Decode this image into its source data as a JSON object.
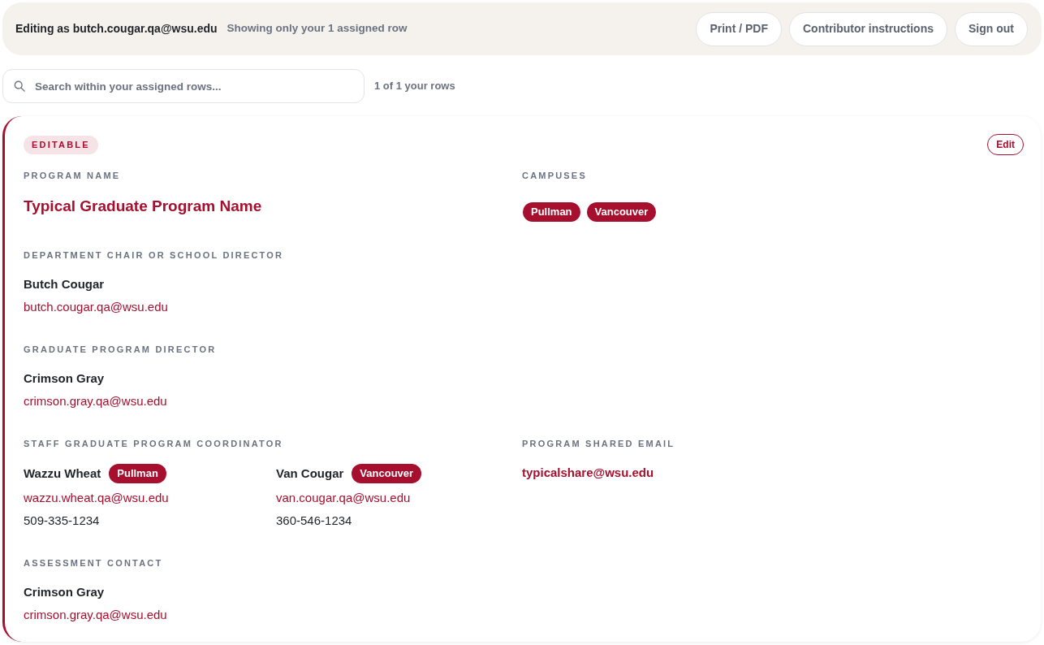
{
  "header": {
    "user_text": "Editing as butch.cougar.qa@wsu.edu",
    "scope_text": "Showing only your 1 assigned row",
    "buttons": [
      "Print / PDF",
      "Contributor instructions",
      "Sign out"
    ]
  },
  "search": {
    "placeholder": "Search within your assigned rows...",
    "count": "1 of 1 your rows"
  },
  "record": {
    "badge": "EDITABLE",
    "edit_button": "Edit",
    "rows": [
      [
        {
          "kind": "title",
          "label": "PROGRAM NAME",
          "value": "Typical Graduate Program Name"
        },
        {
          "kind": "tags",
          "label": "CAMPUSES",
          "tags": [
            "Pullman",
            "Vancouver"
          ]
        }
      ],
      [
        {
          "kind": "person",
          "label": "DEPARTMENT CHAIR OR SCHOOL DIRECTOR",
          "name": "Butch Cougar",
          "email": "butch.cougar.qa@wsu.edu"
        }
      ],
      [
        {
          "kind": "person",
          "label": "GRADUATE PROGRAM DIRECTOR",
          "name": "Crimson Gray",
          "email": "crimson.gray.qa@wsu.edu"
        }
      ],
      [
        {
          "kind": "team",
          "label": "STAFF GRADUATE PROGRAM COORDINATOR",
          "people": [
            {
              "name": "Wazzu Wheat",
              "tag": "Pullman",
              "email": "wazzu.wheat.qa@wsu.edu",
              "phone": "509-335-1234"
            },
            {
              "name": "Van Cougar",
              "tag": "Vancouver",
              "email": "van.cougar.qa@wsu.edu",
              "phone": "360-546-1234"
            }
          ]
        },
        {
          "kind": "email",
          "label": "PROGRAM SHARED EMAIL",
          "value": "typicalshare@wsu.edu"
        }
      ],
      [
        {
          "kind": "person",
          "label": "ASSESSMENT CONTACT",
          "name": "Crimson Gray",
          "email": "crimson.gray.qa@wsu.edu"
        }
      ]
    ]
  }
}
